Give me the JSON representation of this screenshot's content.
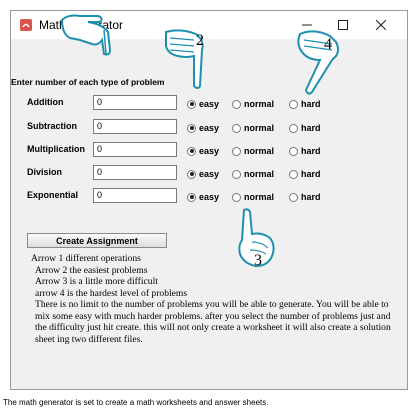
{
  "window": {
    "title": "Math Generator"
  },
  "instruction": "Enter number of each type of problem",
  "rows": [
    {
      "label": "Addition",
      "value": "0",
      "selected": "easy"
    },
    {
      "label": "Subtraction",
      "value": "0",
      "selected": "easy"
    },
    {
      "label": "Multiplication",
      "value": "0",
      "selected": "easy"
    },
    {
      "label": "Division",
      "value": "0",
      "selected": "easy"
    },
    {
      "label": "Exponential",
      "value": "0",
      "selected": "easy"
    }
  ],
  "difficulty_options": [
    "easy",
    "normal",
    "hard"
  ],
  "create_button": "Create Assignment",
  "notes": [
    "Arrow 1 different operations",
    "Arrow 2 the easiest problems",
    "Arrow 3 is a little more difficult",
    "arrow 4 is the hardest level of problems",
    "There is no limit to the number of problems you will be able to generate. You will be able to mix some easy with much harder problems. after you select the number of problems just and the difficulty just hit create. this will not only create  a worksheet it will also create a solution sheet ing two different files."
  ],
  "caption": "The math generator is set to create a math worksheets and answer sheets.",
  "annotations": {
    "n2": "2",
    "n3": "3",
    "n4": "4"
  },
  "colors": {
    "hand_outline": "#1f8fb0",
    "hand_fill": "#ffffff",
    "selected_dot": "#222222"
  }
}
